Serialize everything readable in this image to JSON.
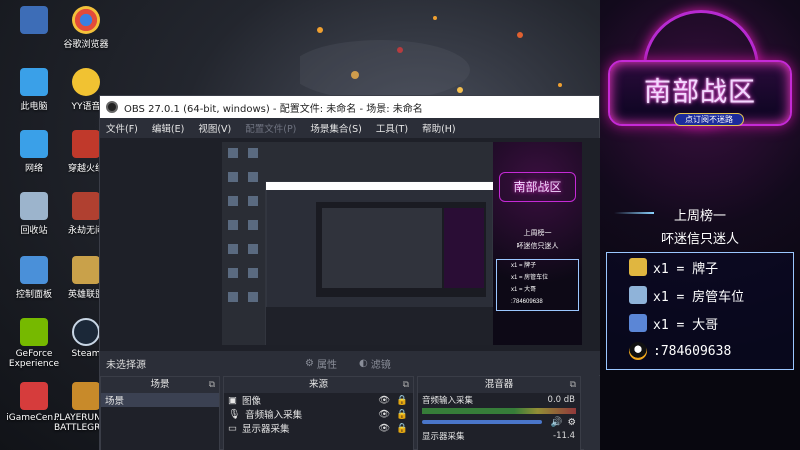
{
  "desktop_icons": [
    {
      "label": "",
      "color": "#3d6db7"
    },
    {
      "label": "谷歌浏览器",
      "color": "#e24b3a"
    },
    {
      "label": "此电脑",
      "color": "#3aa0e8"
    },
    {
      "label": "YY语音",
      "color": "#f1c232"
    },
    {
      "label": "网络",
      "color": "#3aa0e8"
    },
    {
      "label": "穿越火线",
      "color": "#c0392b"
    },
    {
      "label": "回收站",
      "color": "#9cb4cc"
    },
    {
      "label": "永劫无间",
      "color": "#b04030"
    },
    {
      "label": "控制面板",
      "color": "#4a90d9"
    },
    {
      "label": "英雄联盟",
      "color": "#c9a14a"
    },
    {
      "label": "GeForce Experience",
      "color": "#76b900"
    },
    {
      "label": "Steam",
      "color": "#1b2838"
    },
    {
      "label": "iGameCen...",
      "color": "#d63c3c"
    },
    {
      "label": "PLAYERUNKNOWN'S BATTLEGROUNDS",
      "color": "#c88a2a"
    }
  ],
  "obs": {
    "title": "OBS 27.0.1 (64-bit, windows) - 配置文件: 未命名 - 场景: 未命名",
    "menu": [
      "文件(F)",
      "编辑(E)",
      "视图(V)",
      "配置文件(P)",
      "场景集合(S)",
      "工具(T)",
      "帮助(H)"
    ],
    "no_source": "未选择源",
    "properties": "属性",
    "filters": "滤镜",
    "scenes_title": "场景",
    "scenes": [
      "场景"
    ],
    "sources_title": "来源",
    "sources": [
      "图像",
      "音频输入采集",
      "显示器采集"
    ],
    "mixer_title": "混音器",
    "mixer_channel": "音频输入采集",
    "mixer_db": "0.0 dB",
    "mixer_channel_2": "显示器采集",
    "mixer_db_2": "-11.4"
  },
  "panel": {
    "logo_text": "南部战区",
    "logo_sub": "点订阅不迷路",
    "rank_title": "上周榜一",
    "rank_sub": "吥迷信只迷人",
    "ranks": [
      {
        "text": "x1 = 牌子",
        "icon_color": "#e0b640"
      },
      {
        "text": "x1 = 房管车位",
        "icon_color": "#8fb3d9"
      },
      {
        "text": "x1 = 大哥",
        "icon_color": "#5b86d6"
      }
    ],
    "qq": ":784609638"
  }
}
